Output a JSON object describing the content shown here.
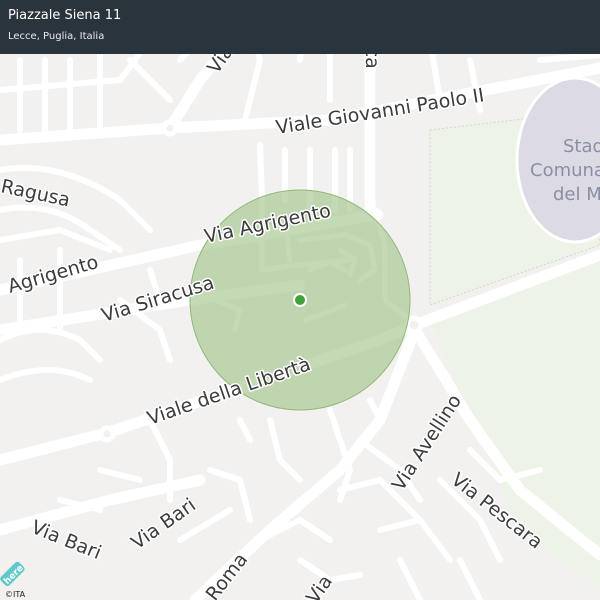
{
  "header": {
    "title": "Piazzale Siena 11",
    "subtitle": "Lecce, Puglia, Italia"
  },
  "streets": {
    "pistoia": "Via Pistoia",
    "lucca": "Lucca",
    "giovanni_paolo": "Viale Giovanni Paolo II",
    "ragusa": "Ragusa",
    "agrigento_east": "Via Agrigento",
    "agrigento_west": "Agrigento",
    "siracusa": "Via Siracusa",
    "liberta": "Viale della Libertà",
    "avellino": "Via Avellino",
    "pescara": "Via Pescara",
    "bari_left": "Via Bari",
    "bari_right": "Via Bari",
    "roma": "Roma",
    "bottom_via": "Via"
  },
  "poi": {
    "stadium_line1": "Stad",
    "stadium_line2": "Comuna",
    "stadium_line3": "del M"
  },
  "logo": {
    "text": "here"
  },
  "attribution": "©ITA",
  "colors": {
    "header_bg": "#2a343d",
    "accuracy_circle": "#9fc487",
    "location_dot": "#3fa23d",
    "park": "#eef3e8",
    "stadium": "#d9d9e2",
    "road": "#ffffff",
    "land": "#f2f1ef"
  }
}
